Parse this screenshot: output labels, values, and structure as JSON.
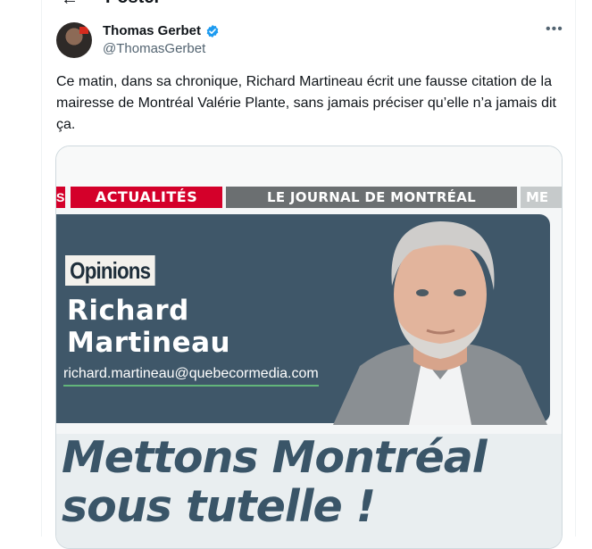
{
  "header": {
    "title": "Poster",
    "back_icon": "arrow-left-icon"
  },
  "tweet": {
    "author": {
      "name": "Thomas Gerbet",
      "handle": "@ThomasGerbet",
      "verified": true,
      "verified_icon": "verified-badge-icon",
      "verified_color": "#1d9bf0"
    },
    "more_icon": "more-horizontal-icon",
    "text": "Ce matin, dans sa chronique, Richard Martineau écrit une fausse citation de la mairesse de Montréal Valérie Plante, sans jamais préciser qu’elle n’a jamais dit ça."
  },
  "media": {
    "red_stub": "S",
    "section": "ACTUALITÉS",
    "journal": "LE JOURNAL DE MONTRÉAL",
    "next_section": "ME",
    "opinions_label": "Opinions",
    "columnist_first": "Richard",
    "columnist_last": "Martineau",
    "email": "richard.martineau@quebecormedia.com",
    "headline_line1": "Mettons Montréal",
    "headline_line2": "sous tutelle !",
    "colors": {
      "section_red": "#d4002a",
      "panel_blue": "#3f5769",
      "headline_blue": "#3a5568"
    }
  }
}
